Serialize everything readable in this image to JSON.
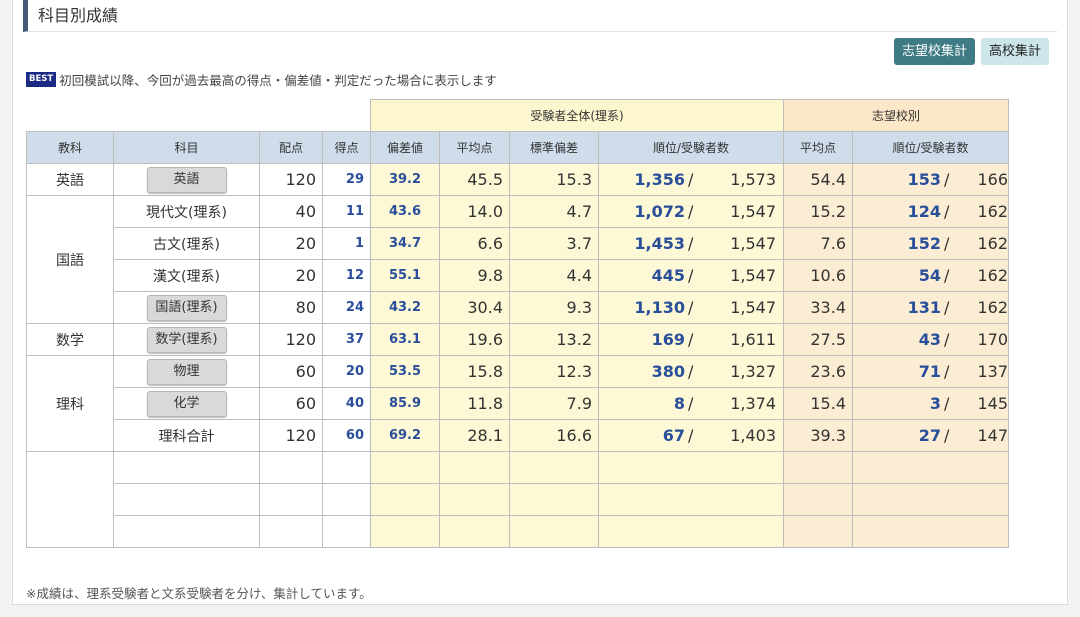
{
  "section_title": "科目別成績",
  "buttons": {
    "school_agg": "志望校集計",
    "hs_agg": "高校集計"
  },
  "best": {
    "badge": "BEST",
    "text": "初回模試以降、今回が過去最高の得点・偏差値・判定だった場合に表示します"
  },
  "groups": {
    "all": "受験者全体(理系)",
    "school": "志望校別"
  },
  "headers": {
    "kyoka": "教科",
    "kamoku": "科目",
    "haiten": "配点",
    "tokuten": "得点",
    "hensachi": "偏差値",
    "heikin": "平均点",
    "hyojun": "標準偏差",
    "juni": "順位/受験者数",
    "s_heikin": "平均点",
    "s_juni": "順位/受験者数"
  },
  "rank_separator": "/",
  "kyoka": {
    "english": "英語",
    "japanese": "国語",
    "math": "数学",
    "science": "理科"
  },
  "rows": [
    {
      "subject": "英語",
      "button": true,
      "max": "120",
      "score": "29",
      "dev": "39.2",
      "avg": "45.5",
      "sd": "15.3",
      "rank": "1,356",
      "total": "1,573",
      "s_avg": "54.4",
      "s_rank": "153",
      "s_total": "166"
    },
    {
      "subject": "現代文(理系)",
      "button": false,
      "max": "40",
      "score": "11",
      "dev": "43.6",
      "avg": "14.0",
      "sd": "4.7",
      "rank": "1,072",
      "total": "1,547",
      "s_avg": "15.2",
      "s_rank": "124",
      "s_total": "162"
    },
    {
      "subject": "古文(理系)",
      "button": false,
      "max": "20",
      "score": "1",
      "dev": "34.7",
      "avg": "6.6",
      "sd": "3.7",
      "rank": "1,453",
      "total": "1,547",
      "s_avg": "7.6",
      "s_rank": "152",
      "s_total": "162"
    },
    {
      "subject": "漢文(理系)",
      "button": false,
      "max": "20",
      "score": "12",
      "dev": "55.1",
      "avg": "9.8",
      "sd": "4.4",
      "rank": "445",
      "total": "1,547",
      "s_avg": "10.6",
      "s_rank": "54",
      "s_total": "162"
    },
    {
      "subject": "国語(理系)",
      "button": true,
      "max": "80",
      "score": "24",
      "dev": "43.2",
      "avg": "30.4",
      "sd": "9.3",
      "rank": "1,130",
      "total": "1,547",
      "s_avg": "33.4",
      "s_rank": "131",
      "s_total": "162"
    },
    {
      "subject": "数学(理系)",
      "button": true,
      "max": "120",
      "score": "37",
      "dev": "63.1",
      "avg": "19.6",
      "sd": "13.2",
      "rank": "169",
      "total": "1,611",
      "s_avg": "27.5",
      "s_rank": "43",
      "s_total": "170"
    },
    {
      "subject": "物理",
      "button": true,
      "max": "60",
      "score": "20",
      "dev": "53.5",
      "avg": "15.8",
      "sd": "12.3",
      "rank": "380",
      "total": "1,327",
      "s_avg": "23.6",
      "s_rank": "71",
      "s_total": "137"
    },
    {
      "subject": "化学",
      "button": true,
      "max": "60",
      "score": "40",
      "dev": "85.9",
      "avg": "11.8",
      "sd": "7.9",
      "rank": "8",
      "total": "1,374",
      "s_avg": "15.4",
      "s_rank": "3",
      "s_total": "145"
    },
    {
      "subject": "理科合計",
      "button": false,
      "max": "120",
      "score": "60",
      "dev": "69.2",
      "avg": "28.1",
      "sd": "16.6",
      "rank": "67",
      "total": "1,403",
      "s_avg": "39.3",
      "s_rank": "27",
      "s_total": "147"
    }
  ],
  "footnote": "※成績は、理系受験者と文系受験者を分け、集計しています。"
}
